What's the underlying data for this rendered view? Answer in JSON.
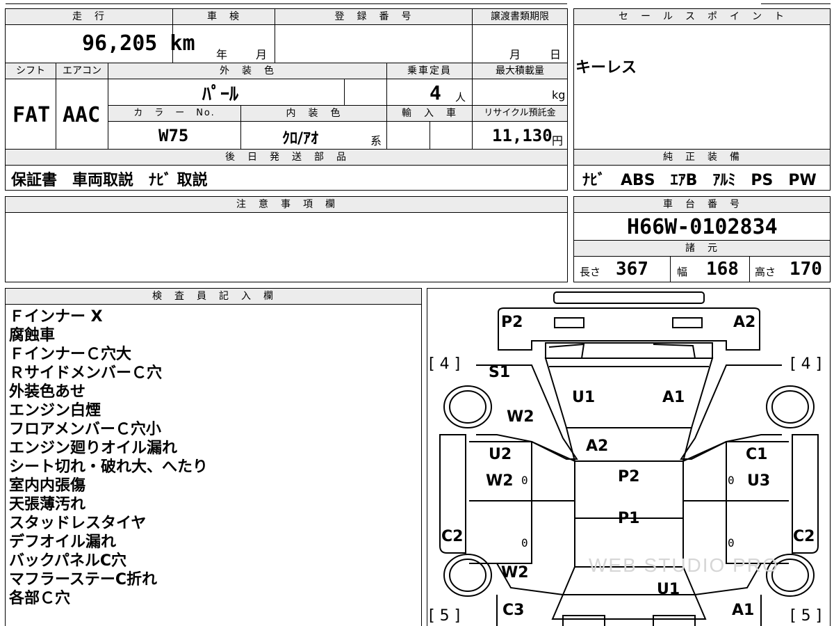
{
  "mileage": {
    "header": "走　行",
    "value": "96,205 km"
  },
  "shaken": {
    "header": "車　検",
    "year_unit": "年",
    "month_unit": "月"
  },
  "registration": {
    "header": "登　録　番　号"
  },
  "transfer_deadline": {
    "header": "譲渡書類期限",
    "month_unit": "月",
    "day_unit": "日"
  },
  "shift": {
    "header": "シフト",
    "value": "FAT"
  },
  "aircon": {
    "header": "エアコン",
    "value": "AAC"
  },
  "exterior_color": {
    "header": "外　装　色",
    "value": "ﾊﾟｰﾙ"
  },
  "capacity": {
    "header": "乗車定員",
    "value": "4",
    "unit": "人"
  },
  "max_load": {
    "header": "最大積載量",
    "unit": "kg"
  },
  "color_no": {
    "header": "カ　ラ　ー　No.",
    "value": "W75"
  },
  "interior_color": {
    "header": "内　装　色",
    "value": "ｸﾛ/ｱｵ",
    "suffix": "系"
  },
  "import": {
    "header": "輸　入　車"
  },
  "recycle": {
    "header": "リサイクル預託金",
    "value": "11,130",
    "unit": "円"
  },
  "later_parts": {
    "header": "後　日　発　送　部　品",
    "value": "保証書　車両取説　ﾅﾋﾞ 取説"
  },
  "sales_points": {
    "header": "セ　ー　ル　ス　ポ　イ　ン　ト",
    "value": "キーレス"
  },
  "equipment": {
    "header": "純　正　装　備",
    "value": "ﾅﾋﾞ　ABS　ｴｱB　ｱﾙﾐ　PS　PW"
  },
  "caution": {
    "header": "注　意　事　項　欄"
  },
  "chassis": {
    "header": "車　台　番　号",
    "value": "H66W-0102834"
  },
  "specs": {
    "header": "諸　元",
    "length_label": "長さ",
    "length": "367",
    "width_label": "幅",
    "width": "168",
    "height_label": "高さ",
    "height": "170"
  },
  "inspector": {
    "header": "検　査　員　記　入　欄",
    "notes": [
      "Ｆインナー X",
      "腐蝕車",
      "ＦインナーＣ穴大",
      "ＲサイドメンバーＣ穴",
      "外装色あせ",
      "エンジン白煙",
      "フロアメンバーＣ穴小",
      "エンジン廻りオイル漏れ",
      "シート切れ・破れ大、へたり",
      "室内内張傷",
      "天張薄汚れ",
      "スタッドレスタイヤ",
      "デフオイル漏れ",
      "バックパネルC穴",
      "マフラーステーC折れ",
      "各部Ｃ穴"
    ]
  },
  "diagram": {
    "tire_fl": "[ 4 ]",
    "tire_fr": "[ 4 ]",
    "tire_rl": "[ 5 ]",
    "tire_rr": "[ 5 ]",
    "labels": {
      "p2_front_left": "P2",
      "a2_front_right": "A2",
      "s1": "S1",
      "w2_left_front": "W2",
      "u1_hood": "U1",
      "a1_hood": "A1",
      "a2_windshield": "A2",
      "u2_left_door": "U2",
      "w2_left_door": "W2",
      "c1_right_door": "C1",
      "u3_right_door": "U3",
      "p2_roof": "P2",
      "p1_roof": "P1",
      "c2_left": "C2",
      "c2_right": "C2",
      "w2_left_rear": "W2",
      "u1_rear": "U1",
      "c3_rear_left": "C3",
      "a1_rear_right": "A1"
    },
    "zero_mark": "0",
    "watermark": "WEB STUDIO PRO"
  }
}
